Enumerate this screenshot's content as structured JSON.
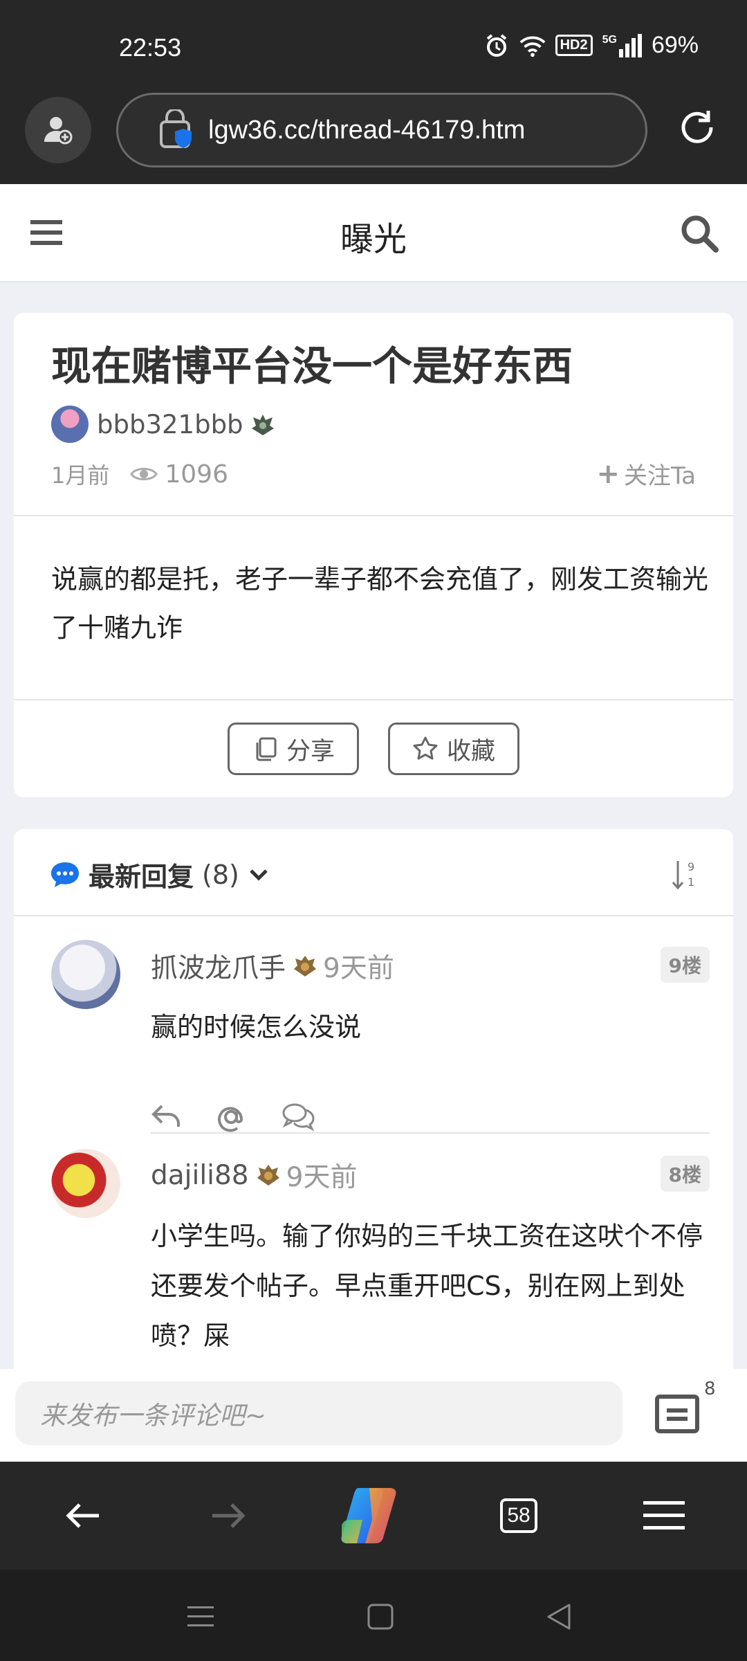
{
  "status_bar": {
    "time": "22:53",
    "battery": "69%",
    "network": "5G",
    "hd_label": "HD2"
  },
  "browser": {
    "url": "lgw36.cc/thread-46179.htm",
    "tab_count": "58"
  },
  "site": {
    "title": "曝光"
  },
  "post": {
    "title": "现在赌博平台没一个是好东西",
    "author": "bbb321bbb",
    "time": "1月前",
    "views": "1096",
    "follow_label": "关注Ta",
    "body": "说赢的都是托，老子一辈子都不会充值了，刚发工资输光了十赌九诈",
    "share_label": "分享",
    "favorite_label": "收藏"
  },
  "replies_header": {
    "title": "最新回复",
    "count": "(8)"
  },
  "replies": [
    {
      "name": "抓波龙爪手",
      "time": "9天前",
      "floor": "9楼",
      "text": "赢的时候怎么没说"
    },
    {
      "name": "dajili88",
      "time": "9天前",
      "floor": "8楼",
      "text": "小学生吗。输了你妈的三千块工资在这吠个不停还要发个帖子。早点重开吧CS，别在网上到处喷？屎"
    }
  ],
  "comment_bar": {
    "placeholder": "来发布一条评论吧~",
    "count": "8"
  },
  "colors": {
    "dark_bar": "#272727",
    "accent_blue": "#1a73e8",
    "bg": "#eef0f5"
  }
}
